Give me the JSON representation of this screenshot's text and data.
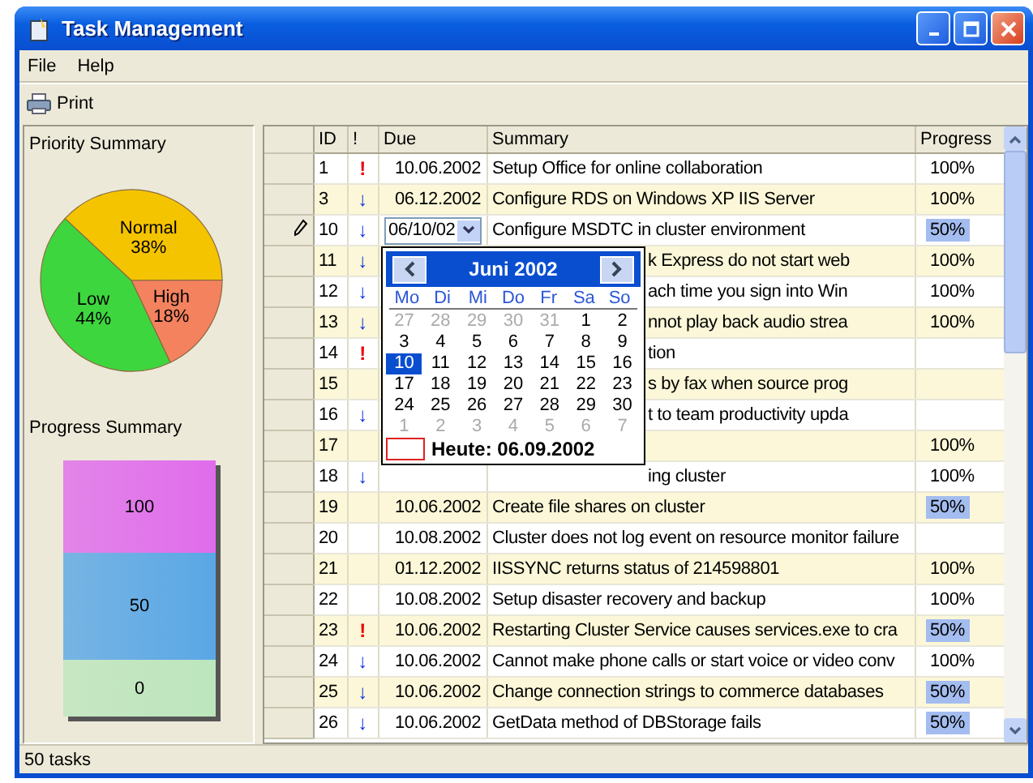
{
  "window": {
    "title": "Task Management"
  },
  "menu": [
    "File",
    "Help"
  ],
  "toolbar": [
    {
      "label": "Print",
      "kind": "print"
    }
  ],
  "priority_summary": {
    "title": "Priority Summary",
    "chart_data": {
      "type": "pie",
      "categories": [
        "Normal",
        "High",
        "Low"
      ],
      "values": [
        38,
        18,
        44
      ],
      "colors": [
        "#f5c400",
        "#f4825f",
        "#3ed63e"
      ],
      "value_labels": [
        "38%",
        "18%",
        "44%"
      ]
    }
  },
  "progress_summary": {
    "title": "Progress Summary",
    "segments": [
      {
        "label": "100",
        "color": "#e06cec"
      },
      {
        "label": "50",
        "color": "#5aa7e6"
      },
      {
        "label": "0",
        "color": "#bde6bd"
      }
    ]
  },
  "grid": {
    "columns": [
      "ID",
      "!",
      "Due",
      "Summary",
      "Progress"
    ],
    "rows": [
      {
        "id": "1",
        "priority": "!",
        "urgent": true,
        "due": "10.06.2002",
        "summary": "Setup Office for online collaboration",
        "progress": "100%",
        "highlighted": false,
        "editing": false
      },
      {
        "id": "3",
        "priority": "↓",
        "urgent": false,
        "due": "06.12.2002",
        "summary": "Configure RDS on Windows XP IIS Server",
        "progress": "100%",
        "highlighted": false,
        "editing": false
      },
      {
        "id": "10",
        "priority": "↓",
        "urgent": false,
        "due": "06/10/02",
        "summary": "Configure MSDTC in cluster environment",
        "progress": "50%",
        "highlighted": true,
        "editing": true
      },
      {
        "id": "11",
        "priority": "↓",
        "urgent": false,
        "summary": "k Express do not start web",
        "behind_popup": true,
        "progress": "100%",
        "highlighted": false,
        "editing": false
      },
      {
        "id": "12",
        "priority": "↓",
        "urgent": false,
        "summary": "ach time you sign into Win",
        "behind_popup": true,
        "progress": "100%",
        "highlighted": false,
        "editing": false
      },
      {
        "id": "13",
        "priority": "↓",
        "urgent": false,
        "summary": "nnot play back audio strea",
        "behind_popup": true,
        "progress": "100%",
        "highlighted": false,
        "editing": false
      },
      {
        "id": "14",
        "priority": "!",
        "urgent": true,
        "summary": "tion",
        "behind_popup": true,
        "editing": false
      },
      {
        "id": "15",
        "summary": "s by fax when source prog",
        "behind_popup": true,
        "editing": false
      },
      {
        "id": "16",
        "priority": "↓",
        "urgent": false,
        "summary": "t to team productivity upda",
        "behind_popup": true,
        "editing": false
      },
      {
        "id": "17",
        "progress": "100%",
        "highlighted": false,
        "editing": false
      },
      {
        "id": "18",
        "priority": "↓",
        "urgent": false,
        "summary": "ing cluster",
        "behind_popup": true,
        "progress": "100%",
        "highlighted": false,
        "editing": false
      },
      {
        "id": "19",
        "due": "10.06.2002",
        "summary": "Create file shares on cluster",
        "progress": "50%",
        "highlighted": true,
        "editing": false
      },
      {
        "id": "20",
        "due": "10.08.2002",
        "summary": "Cluster does not log event on resource monitor failure",
        "editing": false
      },
      {
        "id": "21",
        "due": "01.12.2002",
        "summary": "IISSYNC returns status of 214598801",
        "progress": "100%",
        "highlighted": false,
        "editing": false
      },
      {
        "id": "22",
        "due": "10.08.2002",
        "summary": "Setup disaster recovery and backup",
        "progress": "100%",
        "highlighted": false,
        "editing": false
      },
      {
        "id": "23",
        "priority": "!",
        "urgent": true,
        "due": "10.06.2002",
        "summary": "Restarting Cluster Service causes services.exe to cra",
        "progress": "50%",
        "highlighted": true,
        "editing": false
      },
      {
        "id": "24",
        "priority": "↓",
        "urgent": false,
        "due": "10.06.2002",
        "summary": "Cannot make phone calls or start voice or video conv",
        "progress": "100%",
        "highlighted": false,
        "editing": false
      },
      {
        "id": "25",
        "priority": "↓",
        "urgent": false,
        "due": "10.06.2002",
        "summary": "Change connection strings to commerce databases",
        "progress": "50%",
        "highlighted": true,
        "editing": false
      },
      {
        "id": "26",
        "priority": "↓",
        "urgent": false,
        "due": "10.06.2002",
        "summary": "GetData method of DBStorage fails",
        "progress": "50%",
        "highlighted": true,
        "editing": false
      }
    ]
  },
  "calendar": {
    "month": "Juni 2002",
    "weekdays": [
      "Mo",
      "Di",
      "Mi",
      "Do",
      "Fr",
      "Sa",
      "So"
    ],
    "weeks": [
      [
        {
          "day": "27",
          "other_month": true,
          "selected": false
        },
        {
          "day": "28",
          "other_month": true,
          "selected": false
        },
        {
          "day": "29",
          "other_month": true,
          "selected": false
        },
        {
          "day": "30",
          "other_month": true,
          "selected": false
        },
        {
          "day": "31",
          "other_month": true,
          "selected": false
        },
        {
          "day": "1",
          "other_month": false,
          "selected": false
        },
        {
          "day": "2",
          "other_month": false,
          "selected": false
        }
      ],
      [
        {
          "day": "3",
          "other_month": false,
          "selected": false
        },
        {
          "day": "4",
          "other_month": false,
          "selected": false
        },
        {
          "day": "5",
          "other_month": false,
          "selected": false
        },
        {
          "day": "6",
          "other_month": false,
          "selected": false
        },
        {
          "day": "7",
          "other_month": false,
          "selected": false
        },
        {
          "day": "8",
          "other_month": false,
          "selected": false
        },
        {
          "day": "9",
          "other_month": false,
          "selected": false
        }
      ],
      [
        {
          "day": "10",
          "other_month": false,
          "selected": true
        },
        {
          "day": "11",
          "other_month": false,
          "selected": false
        },
        {
          "day": "12",
          "other_month": false,
          "selected": false
        },
        {
          "day": "13",
          "other_month": false,
          "selected": false
        },
        {
          "day": "14",
          "other_month": false,
          "selected": false
        },
        {
          "day": "15",
          "other_month": false,
          "selected": false
        },
        {
          "day": "16",
          "other_month": false,
          "selected": false
        }
      ],
      [
        {
          "day": "17",
          "other_month": false,
          "selected": false
        },
        {
          "day": "18",
          "other_month": false,
          "selected": false
        },
        {
          "day": "19",
          "other_month": false,
          "selected": false
        },
        {
          "day": "20",
          "other_month": false,
          "selected": false
        },
        {
          "day": "21",
          "other_month": false,
          "selected": false
        },
        {
          "day": "22",
          "other_month": false,
          "selected": false
        },
        {
          "day": "23",
          "other_month": false,
          "selected": false
        }
      ],
      [
        {
          "day": "24",
          "other_month": false,
          "selected": false
        },
        {
          "day": "25",
          "other_month": false,
          "selected": false
        },
        {
          "day": "26",
          "other_month": false,
          "selected": false
        },
        {
          "day": "27",
          "other_month": false,
          "selected": false
        },
        {
          "day": "28",
          "other_month": false,
          "selected": false
        },
        {
          "day": "29",
          "other_month": false,
          "selected": false
        },
        {
          "day": "30",
          "other_month": false,
          "selected": false
        }
      ],
      [
        {
          "day": "1",
          "other_month": true,
          "selected": false
        },
        {
          "day": "2",
          "other_month": true,
          "selected": false
        },
        {
          "day": "3",
          "other_month": true,
          "selected": false
        },
        {
          "day": "4",
          "other_month": true,
          "selected": false
        },
        {
          "day": "5",
          "other_month": true,
          "selected": false
        },
        {
          "day": "6",
          "other_month": true,
          "selected": false
        },
        {
          "day": "7",
          "other_month": true,
          "selected": false
        }
      ]
    ],
    "today": "Heute: 06.09.2002"
  },
  "status_bar": "50 tasks"
}
